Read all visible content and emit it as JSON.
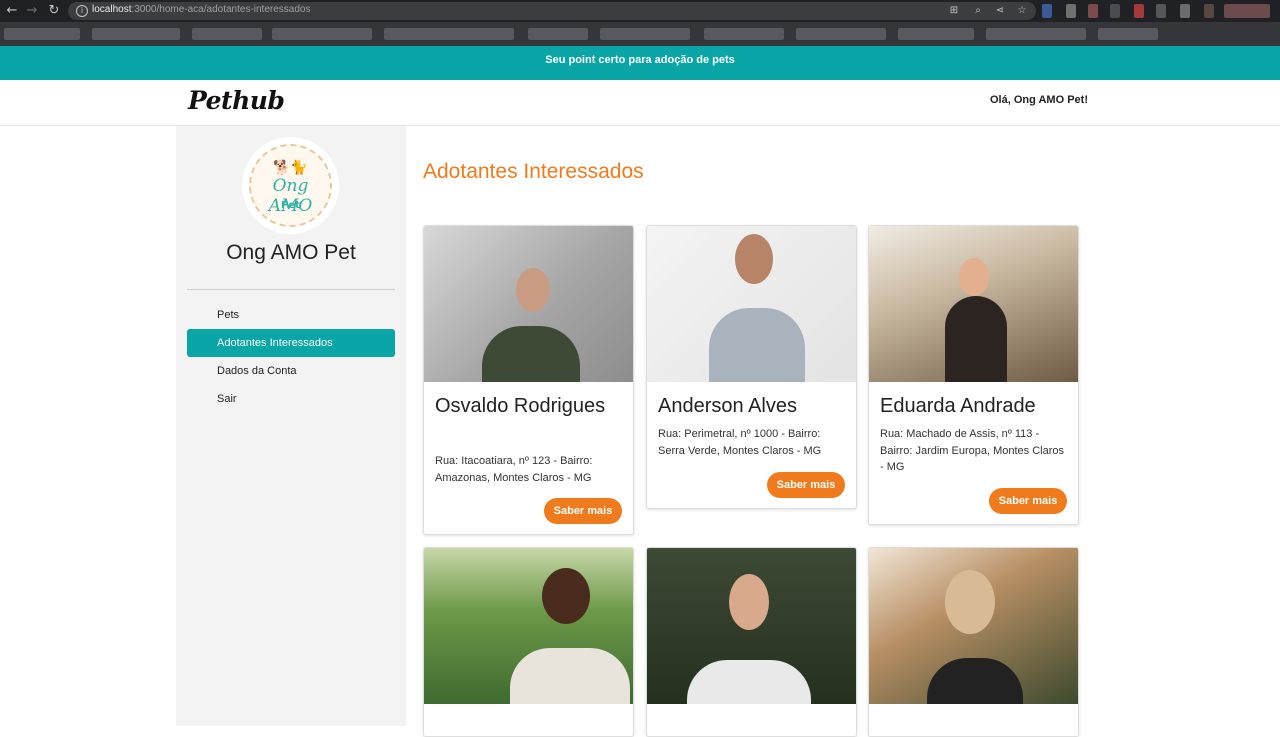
{
  "browser": {
    "url_host": "localhost",
    "url_rest": ":3000/home-aca/adotantes-interessados"
  },
  "banner": {
    "text": "Seu point certo para adoção de pets"
  },
  "header": {
    "logo": "Pethub",
    "greeting": "Olá, Ong AMO Pet!"
  },
  "sidebar": {
    "avatar": {
      "line1": "Ong AMO",
      "line2": "Pet"
    },
    "org_name": "Ong AMO Pet",
    "menu": [
      {
        "label": "Pets",
        "active": false
      },
      {
        "label": "Adotantes Interessados",
        "active": true
      },
      {
        "label": "Dados da Conta",
        "active": false
      },
      {
        "label": "Sair",
        "active": false
      }
    ]
  },
  "main": {
    "title": "Adotantes Interessados",
    "cards": [
      {
        "name": "Osvaldo Rodrigues",
        "address": "Rua: Itacoatiara, nº 123 - Bairro: Amazonas, Montes Claros - MG",
        "button": "Saber mais"
      },
      {
        "name": "Anderson Alves",
        "address": "Rua: Perimetral, nº 1000 - Bairro: Serra Verde, Montes Claros - MG",
        "button": "Saber mais"
      },
      {
        "name": "Eduarda Andrade",
        "address": "Rua: Machado de Assis, nº 113 - Bairro: Jardim Europa, Montes Claros - MG",
        "button": "Saber mais"
      }
    ]
  },
  "colors": {
    "teal": "#0aa5a6",
    "orange": "#f07b1d"
  }
}
